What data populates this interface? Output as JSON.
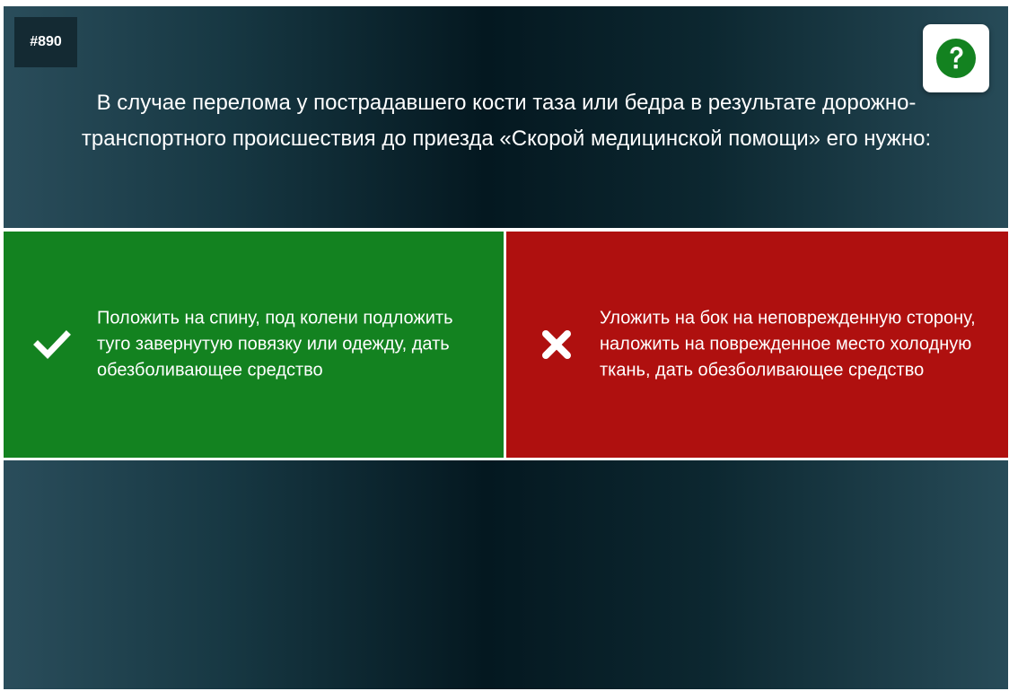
{
  "question": {
    "id_label": "#890",
    "text": "В случае перелома у пострадавшего кости таза или бедра в результате дорожно-транспортного происшествия до приезда «Скорой медицинской помощи» его нужно:"
  },
  "help_button": {
    "icon": "question-circle-icon",
    "icon_color": "#138220"
  },
  "answers": [
    {
      "text": "Положить на спину, под колени подложить туго завернутую повязку или одежду, дать обезболивающее средство",
      "state": "correct",
      "icon": "check-icon",
      "color": "#138220"
    },
    {
      "text": "Уложить на бок на неповрежденную сторону, наложить на поврежденное место холодную ткань, дать обезболивающее средство",
      "state": "wrong",
      "icon": "cross-icon",
      "color": "#af100f"
    }
  ]
}
